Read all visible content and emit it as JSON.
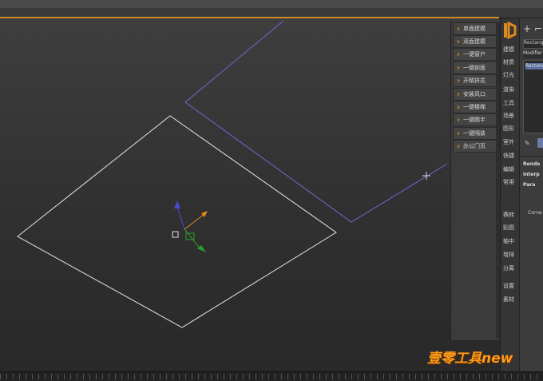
{
  "plugin_menu": {
    "items": [
      {
        "label": "单面建模"
      },
      {
        "label": "双面建模"
      },
      {
        "label": "一键窗户"
      },
      {
        "label": "一键剖面"
      },
      {
        "label": "开精拼花"
      },
      {
        "label": "安装风口"
      },
      {
        "label": "一键楼梯"
      },
      {
        "label": "一键踢半"
      },
      {
        "label": "一键隔装"
      },
      {
        "label": "办公门页"
      }
    ]
  },
  "command_strip": {
    "items_top": [
      "建模",
      "材质",
      "灯光",
      "渲染",
      "工具",
      "场景",
      "图形",
      "室外",
      "快捷",
      "编辑",
      "常用"
    ],
    "items_bottom": [
      "赛转",
      "贴图",
      "轴中",
      "增排",
      "分离",
      "设置",
      "素材"
    ]
  },
  "command_panel": {
    "toolbar_icons": "+ ⌐",
    "object_name": "Rectangle",
    "modifier_list_label": "Modifier List",
    "stack_selected": "Rectangle",
    "rollouts": [
      "Rende",
      "Interp",
      "Para"
    ],
    "param_label": "Corne"
  },
  "watermark": "壹零工具new",
  "colors": {
    "accent": "#e08a1e",
    "selection": "#5b6fa0"
  }
}
